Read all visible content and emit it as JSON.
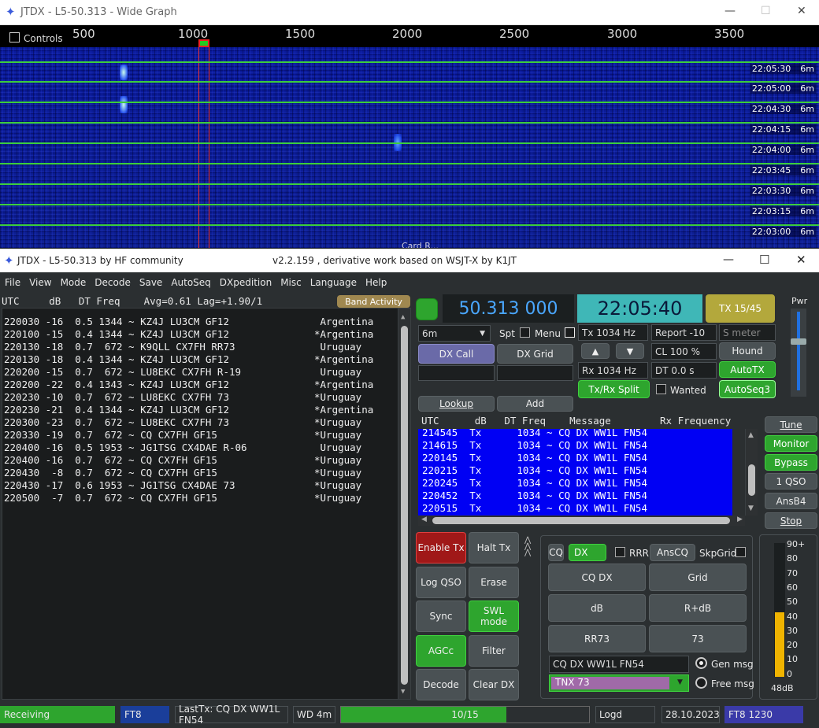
{
  "wide_graph": {
    "title": "JTDX - L5-50.313 - Wide Graph",
    "controls_label": "Controls",
    "ruler": [
      "500",
      "1000",
      "1500",
      "2000",
      "2500",
      "3000",
      "3500"
    ],
    "rows": [
      {
        "time": "22:05:30",
        "band": "6m"
      },
      {
        "time": "22:05:00",
        "band": "6m"
      },
      {
        "time": "22:04:30",
        "band": "6m"
      },
      {
        "time": "22:04:15",
        "band": "6m"
      },
      {
        "time": "22:04:00",
        "band": "6m"
      },
      {
        "time": "22:03:45",
        "band": "6m"
      },
      {
        "time": "22:03:30",
        "band": "6m"
      },
      {
        "time": "22:03:15",
        "band": "6m"
      },
      {
        "time": "22:03:00",
        "band": "6m"
      }
    ],
    "footer_label": "Card R..."
  },
  "main": {
    "title_left": "JTDX - L5-50.313  by HF community",
    "title_center": "v2.2.159 , derivative work based on WSJT-X by K1JT",
    "menu": [
      "File",
      "View",
      "Mode",
      "Decode",
      "Save",
      "AutoSeq",
      "DXpedition",
      "Misc",
      "Language",
      "Help"
    ]
  },
  "band_activity": {
    "header": "UTC     dB   DT Freq    Avg=0.61 Lag=+1.90/1",
    "button": "Band Activity",
    "rows": [
      {
        "msg": "220030 -16  0.5 1344 ~ KZ4J LU3CM GF12",
        "country": " Argentina"
      },
      {
        "msg": "220100 -15  0.4 1344 ~ KZ4J LU3CM GF12",
        "country": "*Argentina"
      },
      {
        "msg": "220130 -18  0.7  672 ~ K9QLL CX7FH RR73",
        "country": " Uruguay"
      },
      {
        "msg": "220130 -18  0.4 1344 ~ KZ4J LU3CM GF12",
        "country": "*Argentina"
      },
      {
        "msg": "220200 -15  0.7  672 ~ LU8EKC CX7FH R-19",
        "country": " Uruguay"
      },
      {
        "msg": "220200 -22  0.4 1343 ~ KZ4J LU3CM GF12",
        "country": "*Argentina"
      },
      {
        "msg": "220230 -10  0.7  672 ~ LU8EKC CX7FH 73",
        "country": "*Uruguay"
      },
      {
        "msg": "220230 -21  0.4 1344 ~ KZ4J LU3CM GF12",
        "country": "*Argentina"
      },
      {
        "msg": "220300 -23  0.7  672 ~ LU8EKC CX7FH 73",
        "country": "*Uruguay"
      },
      {
        "msg": "220330 -19  0.7  672 ~ CQ CX7FH GF15",
        "country": "*Uruguay"
      },
      {
        "msg": "220400 -16  0.5 1953 ~ JG1TSG CX4DAE R-06",
        "country": " Uruguay"
      },
      {
        "msg": "220400 -16  0.7  672 ~ CQ CX7FH GF15",
        "country": "*Uruguay"
      },
      {
        "msg": "220430  -8  0.7  672 ~ CQ CX7FH GF15",
        "country": "*Uruguay"
      },
      {
        "msg": "220430 -17  0.6 1953 ~ JG1TSG CX4DAE 73",
        "country": "*Uruguay"
      },
      {
        "msg": "220500  -7  0.7  672 ~ CQ CX7FH GF15",
        "country": "*Uruguay"
      }
    ]
  },
  "top": {
    "frequency": "50.313 000",
    "clock": "22:05:40",
    "tx_period": "TX 15/45",
    "pwr_label": "Pwr",
    "band_select": "6m",
    "spt": "Spt",
    "menu_label": "Menu",
    "tx_freq": "Tx  1034 Hz",
    "report": "Report -10",
    "smeter_placeholder": "S meter",
    "dx_call": "DX Call",
    "dx_grid": "DX Grid",
    "cl": "CL  100 %",
    "hound": "Hound",
    "rx_freq": "Rx  1034 Hz",
    "dt": "DT 0.0 s",
    "autotx": "AutoTX",
    "txrx_split": "Tx/Rx Split",
    "wanted": "Wanted",
    "autoseq": "AutoSeq3",
    "lookup": "Lookup",
    "add": "Add",
    "up": "▲",
    "down": "▼"
  },
  "rx_pane": {
    "header": "UTC      dB   DT Freq    Message",
    "header_right": "Rx Frequency",
    "rows": [
      "214545  Tx      1034 ~ CQ DX WW1L FN54",
      "214615  Tx      1034 ~ CQ DX WW1L FN54",
      "220145  Tx      1034 ~ CQ DX WW1L FN54",
      "220215  Tx      1034 ~ CQ DX WW1L FN54",
      "220245  Tx      1034 ~ CQ DX WW1L FN54",
      "220452  Tx      1034 ~ CQ DX WW1L FN54",
      "220515  Tx      1034 ~ CQ DX WW1L FN54"
    ]
  },
  "side_buttons": [
    "Tune",
    "Monitor",
    "Bypass",
    "1 QSO",
    "AnsB4",
    "Stop"
  ],
  "left_buttons": [
    "Enable Tx",
    "Halt Tx",
    "Log QSO",
    "Erase",
    "Sync",
    "SWL mode",
    "AGCc",
    "Filter",
    "Decode",
    "Clear DX"
  ],
  "tx_panel": {
    "cq": "CQ",
    "dx": "DX",
    "rrr": "RRR",
    "anscq": "AnsCQ",
    "skpgrid": "SkpGrid",
    "grid_buttons": [
      "CQ DX",
      "Grid",
      "dB",
      "R+dB",
      "RR73",
      "73"
    ],
    "gen_msg_value": "CQ DX WW1L FN54",
    "gen_msg": "Gen msg",
    "free_msg_value": "TNX 73",
    "free_msg": "Free msg"
  },
  "meter": {
    "ticks": [
      "90+",
      "80",
      "70",
      "60",
      "50",
      "40",
      "30",
      "20",
      "10",
      "0"
    ],
    "level_label": "48dB",
    "level": 48
  },
  "status": {
    "state": "Receiving",
    "mode": "FT8",
    "last_tx": "LastTx: CQ DX WW1L FN54",
    "wd": "WD 4m",
    "progress": "10/15",
    "progress_fraction": 0.667,
    "logd": "Logd",
    "date": "28.10.2023",
    "mode_freq": "FT8  1230"
  }
}
